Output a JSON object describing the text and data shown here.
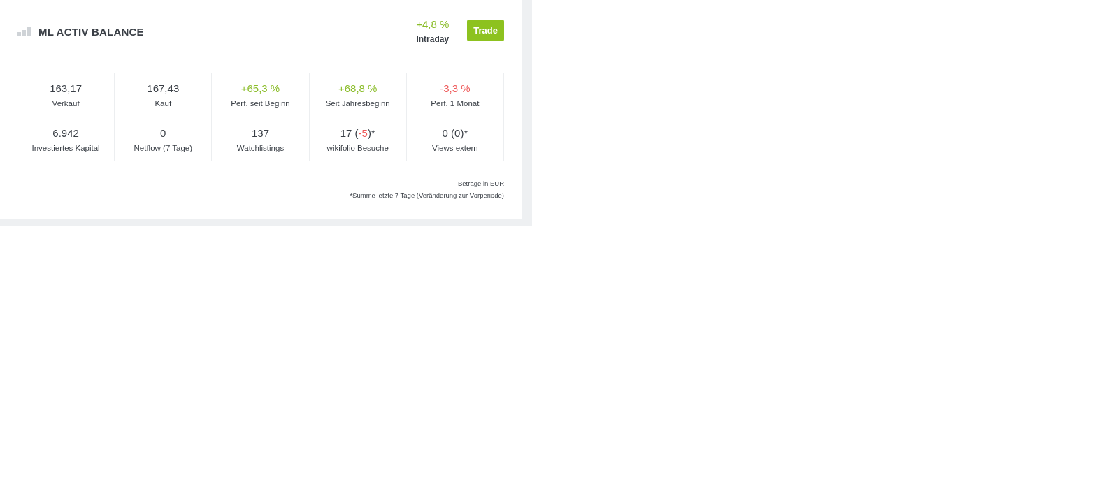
{
  "header": {
    "title": "ML ACTIV BALANCE",
    "change": {
      "text": "+4,8 %",
      "color": "#8bbd2a"
    },
    "change_label": "Intraday",
    "button": "Trade"
  },
  "stats": [
    {
      "parts": [
        {
          "text": "163,17",
          "color": "#3a3f46"
        }
      ],
      "label": "Verkauf"
    },
    {
      "parts": [
        {
          "text": "167,43",
          "color": "#3a3f46"
        }
      ],
      "label": "Kauf"
    },
    {
      "parts": [
        {
          "text": "+65,3 %",
          "color": "#8bbd2a"
        }
      ],
      "label": "Perf. seit Beginn"
    },
    {
      "parts": [
        {
          "text": "+68,8 %",
          "color": "#8bbd2a"
        }
      ],
      "label": "Seit Jahresbeginn"
    },
    {
      "parts": [
        {
          "text": "-3,3 %",
          "color": "#ee5a5a"
        }
      ],
      "label": "Perf. 1 Monat"
    },
    {
      "parts": [
        {
          "text": "6.942",
          "color": "#3a3f46"
        }
      ],
      "label": "Investiertes Kapital"
    },
    {
      "parts": [
        {
          "text": "0",
          "color": "#3a3f46"
        }
      ],
      "label": "Netflow (7 Tage)"
    },
    {
      "parts": [
        {
          "text": "137",
          "color": "#3a3f46"
        }
      ],
      "label": "Watchlistings"
    },
    {
      "parts": [
        {
          "text": "17 (",
          "color": "#3a3f46"
        },
        {
          "text": "-5",
          "color": "#ee5a5a"
        },
        {
          "text": ")*",
          "color": "#3a3f46"
        }
      ],
      "label": "wikifolio Besuche"
    },
    {
      "parts": [
        {
          "text": "0 (0)*",
          "color": "#3a3f46"
        }
      ],
      "label": "Views extern"
    }
  ],
  "footnotes": [
    "Beträge in EUR",
    "*Summe letzte 7 Tage (Veränderung zur Vorperiode)"
  ]
}
